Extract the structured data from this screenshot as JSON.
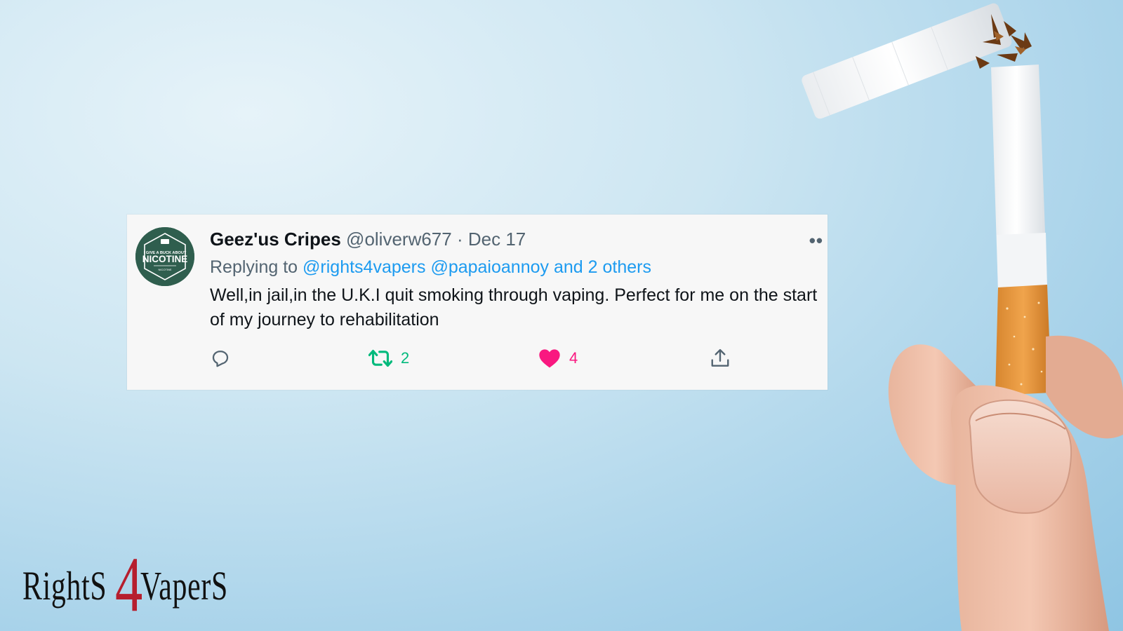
{
  "tweet": {
    "display_name": "Geez'us Cripes",
    "handle": "@oliverw677",
    "separator": "·",
    "date": "Dec 17",
    "more_label": "••",
    "replying_prefix": "Replying to",
    "mention_1": "@rights4vapers",
    "mention_2": "@papaioannoy",
    "mention_others": "and 2 others",
    "body": "Well,in jail,in the U.K.I quit smoking through vaping. Perfect for me on the start of my journey to rehabilitation",
    "avatar": {
      "top_text": "I GIVE A BUCK ABOUT",
      "main_text": "NICOTINE",
      "bottom_text": "NICOTINE"
    },
    "actions": {
      "reply_icon": "reply-icon",
      "retweet_icon": "retweet-icon",
      "retweet_count": "2",
      "like_icon": "heart-icon",
      "like_count": "4",
      "share_icon": "share-icon"
    }
  },
  "logo": {
    "left_word": "RightS",
    "number": "4",
    "right_word": "VaperS"
  },
  "colors": {
    "link": "#1d9bf0",
    "retweet": "#00ba7c",
    "like": "#f91880",
    "muted": "#536471",
    "logo_accent": "#b61e2e",
    "avatar_bg": "#2f5e4e"
  }
}
